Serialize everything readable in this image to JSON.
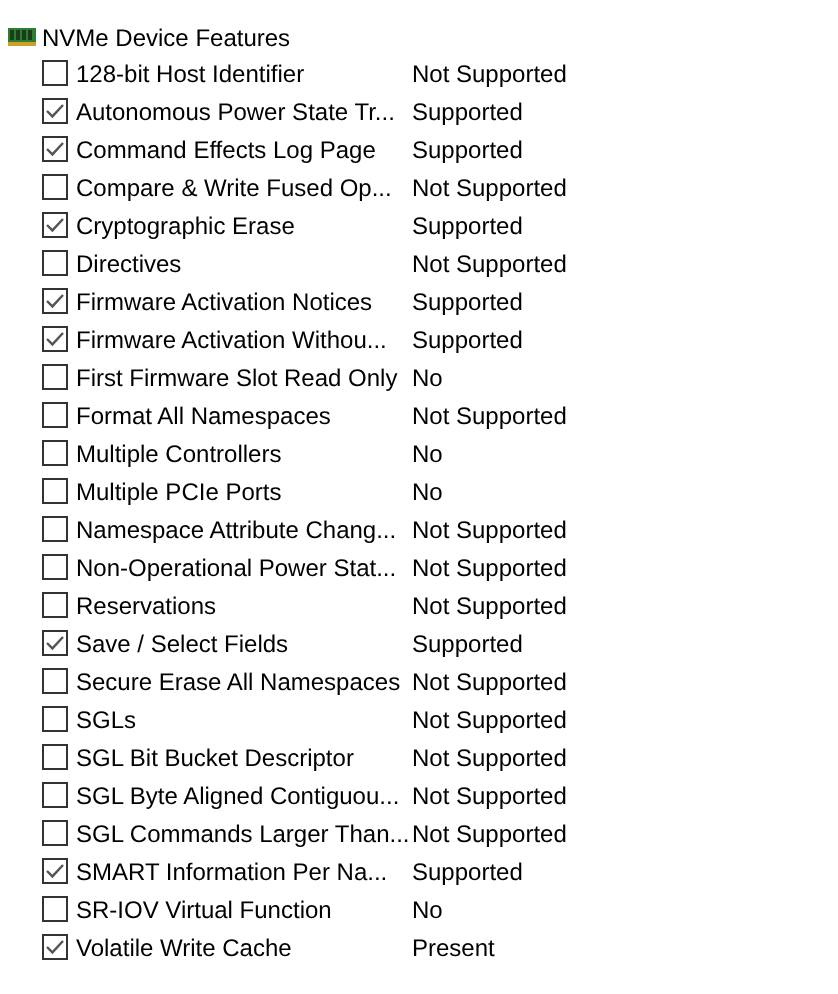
{
  "group": {
    "title": "NVMe Device Features",
    "features": [
      {
        "label": "128-bit Host Identifier",
        "checked": false,
        "value": "Not Supported"
      },
      {
        "label": "Autonomous Power State Tr...",
        "checked": true,
        "value": "Supported"
      },
      {
        "label": "Command Effects Log Page",
        "checked": true,
        "value": "Supported"
      },
      {
        "label": "Compare & Write Fused Op...",
        "checked": false,
        "value": "Not Supported"
      },
      {
        "label": "Cryptographic Erase",
        "checked": true,
        "value": "Supported"
      },
      {
        "label": "Directives",
        "checked": false,
        "value": "Not Supported"
      },
      {
        "label": "Firmware Activation Notices",
        "checked": true,
        "value": "Supported"
      },
      {
        "label": "Firmware Activation Withou...",
        "checked": true,
        "value": "Supported"
      },
      {
        "label": "First Firmware Slot Read Only",
        "checked": false,
        "value": "No"
      },
      {
        "label": "Format All Namespaces",
        "checked": false,
        "value": "Not Supported"
      },
      {
        "label": "Multiple Controllers",
        "checked": false,
        "value": "No"
      },
      {
        "label": "Multiple PCIe Ports",
        "checked": false,
        "value": "No"
      },
      {
        "label": "Namespace Attribute Chang...",
        "checked": false,
        "value": "Not Supported"
      },
      {
        "label": "Non-Operational Power Stat...",
        "checked": false,
        "value": "Not Supported"
      },
      {
        "label": "Reservations",
        "checked": false,
        "value": "Not Supported"
      },
      {
        "label": "Save / Select Fields",
        "checked": true,
        "value": "Supported"
      },
      {
        "label": "Secure Erase All Namespaces",
        "checked": false,
        "value": "Not Supported"
      },
      {
        "label": "SGLs",
        "checked": false,
        "value": "Not Supported"
      },
      {
        "label": "SGL Bit Bucket Descriptor",
        "checked": false,
        "value": "Not Supported"
      },
      {
        "label": "SGL Byte Aligned Contiguou...",
        "checked": false,
        "value": "Not Supported"
      },
      {
        "label": "SGL Commands Larger Than...",
        "checked": false,
        "value": "Not Supported"
      },
      {
        "label": "SMART Information Per Na...",
        "checked": true,
        "value": "Supported"
      },
      {
        "label": "SR-IOV Virtual Function",
        "checked": false,
        "value": "No"
      },
      {
        "label": "Volatile Write Cache",
        "checked": true,
        "value": "Present"
      }
    ]
  }
}
